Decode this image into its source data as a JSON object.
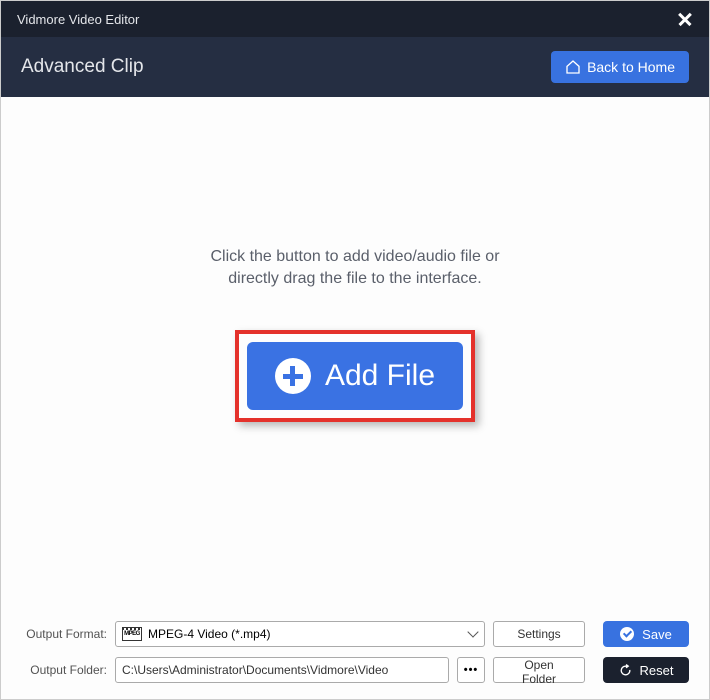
{
  "titlebar": {
    "app_name": "Vidmore Video Editor"
  },
  "header": {
    "title": "Advanced Clip",
    "back_btn": "Back to Home"
  },
  "main": {
    "instruction_line1": "Click the button to add video/audio file or",
    "instruction_line2": "directly drag the file to the interface.",
    "add_file_btn": "Add File"
  },
  "footer": {
    "format_label": "Output Format:",
    "format_value": "MPEG-4 Video (*.mp4)",
    "settings_btn": "Settings",
    "folder_label": "Output Folder:",
    "folder_value": "C:\\Users\\Administrator\\Documents\\Vidmore\\Video",
    "ellipsis": "•••",
    "open_folder_btn": "Open Folder",
    "save_btn": "Save",
    "reset_btn": "Reset"
  }
}
